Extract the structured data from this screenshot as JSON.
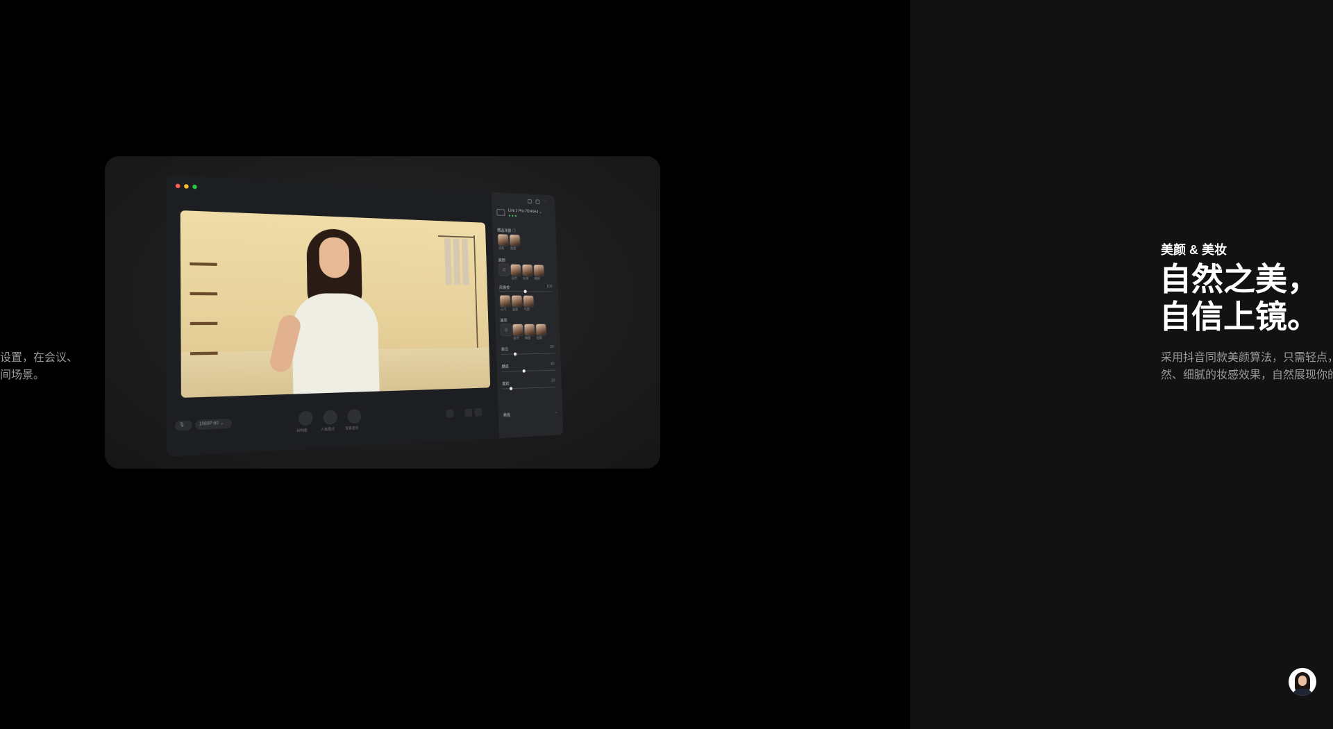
{
  "left_caption": {
    "line1": "设置，在会议、",
    "line2": "间场景。"
  },
  "app": {
    "device_name": "Link 2 Pro-7DH4A4 ⌄",
    "scenes_label": "精选场景 ⓘ",
    "scene_items": [
      "清新",
      "质感"
    ],
    "beauty_label": "美颜",
    "beauty_items": [
      "自然",
      "标准",
      "精致"
    ],
    "filter_label": "风格妆",
    "filter_items": [
      "元气",
      "温柔",
      "气质"
    ],
    "filter_value": "100",
    "makeup_label": "美妆",
    "makeup_items": [
      "自然",
      "精致",
      "甜美"
    ],
    "sliders": [
      {
        "label": "美白",
        "value": "30",
        "level": 0.25
      },
      {
        "label": "磨皮",
        "value": "40",
        "level": 0.4
      },
      {
        "label": "瘦脸",
        "value": "20",
        "level": 0.15
      }
    ],
    "advanced_label": "高级",
    "bottom_left_pill": "1080P 60 ⌄",
    "bottom_buttons": [
      "AI构图",
      "人像模式",
      "背景虚化"
    ]
  },
  "right": {
    "kicker": "美颜 & 美妆",
    "headline1": "自然之美，",
    "headline2": "自信上镜。",
    "desc1": "采用抖音同款美颜算法，只需轻点，",
    "desc2": "然、细腻的妆感效果，自然展现你的"
  },
  "colors": {
    "page_bg": "#000000",
    "right_panel_bg": "#121212",
    "traffic_red": "#ff5f57",
    "traffic_yellow": "#febc2e",
    "traffic_green": "#28c840",
    "status_green": "#3ecf6e"
  },
  "icons": [
    "camera-icon",
    "user-icon",
    "settings-icon",
    "more-icon",
    "mic-icon",
    "grid-icon"
  ]
}
